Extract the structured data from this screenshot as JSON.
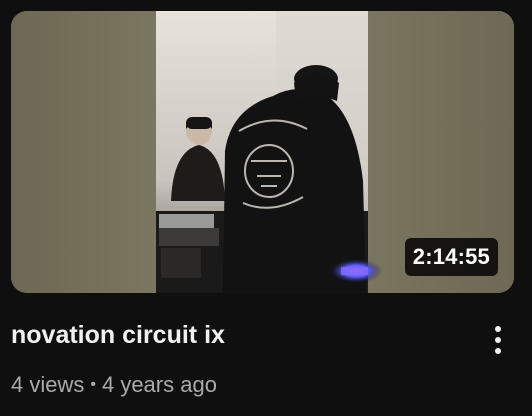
{
  "video": {
    "title": "novation circuit ix",
    "duration": "2:14:55",
    "views": "4 views",
    "separator": "•",
    "age": "4 years ago"
  },
  "icons": {
    "more": "more-vert-icon"
  },
  "colors": {
    "background": "#0f0f0f",
    "title": "#f1f1f1",
    "secondary_text": "#aaaaaa"
  }
}
